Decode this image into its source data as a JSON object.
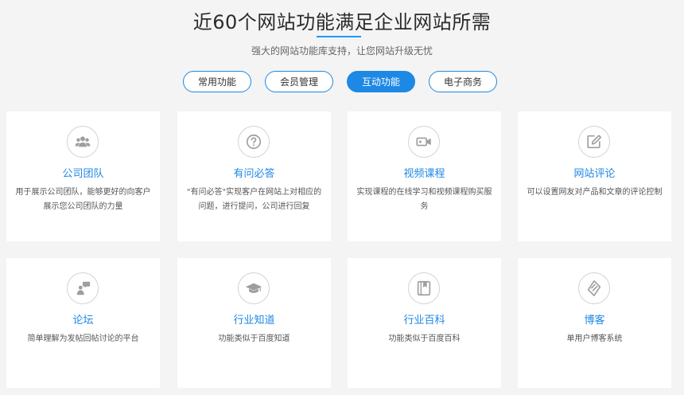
{
  "header": {
    "title": "近60个网站功能满足企业网站所需",
    "subtitle": "强大的网站功能库支持，让您网站升级无忧"
  },
  "tabs": [
    {
      "label": "常用功能",
      "active": false
    },
    {
      "label": "会员管理",
      "active": false
    },
    {
      "label": "互动功能",
      "active": true
    },
    {
      "label": "电子商务",
      "active": false
    }
  ],
  "cards": [
    {
      "icon": "team-icon",
      "title": "公司团队",
      "desc_line1": "用于展示公司团队，能够更好的向客户",
      "desc_line2": "展示您公司团队的力量"
    },
    {
      "icon": "question-icon",
      "title": "有问必答",
      "desc_line1": "\"有问必答\"实现客户在网站上对相应的",
      "desc_line2": "问题，进行提问，公司进行回复"
    },
    {
      "icon": "video-camera-icon",
      "title": "视频课程",
      "desc_line1": "实现课程的在线学习和视频课程购买服",
      "desc_line2": "务"
    },
    {
      "icon": "edit-icon",
      "title": "网站评论",
      "desc_line1": "可以设置网友对产品和文章的评论控制",
      "desc_line2": ""
    },
    {
      "icon": "forum-user-icon",
      "title": "论坛",
      "desc_line1": "简单理解为发帖回帖讨论的平台",
      "desc_line2": ""
    },
    {
      "icon": "graduation-cap-icon",
      "title": "行业知道",
      "desc_line1": "功能类似于百度知道",
      "desc_line2": ""
    },
    {
      "icon": "book-icon",
      "title": "行业百科",
      "desc_line1": "功能类似于百度百科",
      "desc_line2": ""
    },
    {
      "icon": "blog-icon",
      "title": "博客",
      "desc_line1": "单用户博客系统",
      "desc_line2": ""
    }
  ],
  "colors": {
    "accent": "#1e88e5",
    "icon_gray": "#9e9e9e"
  }
}
